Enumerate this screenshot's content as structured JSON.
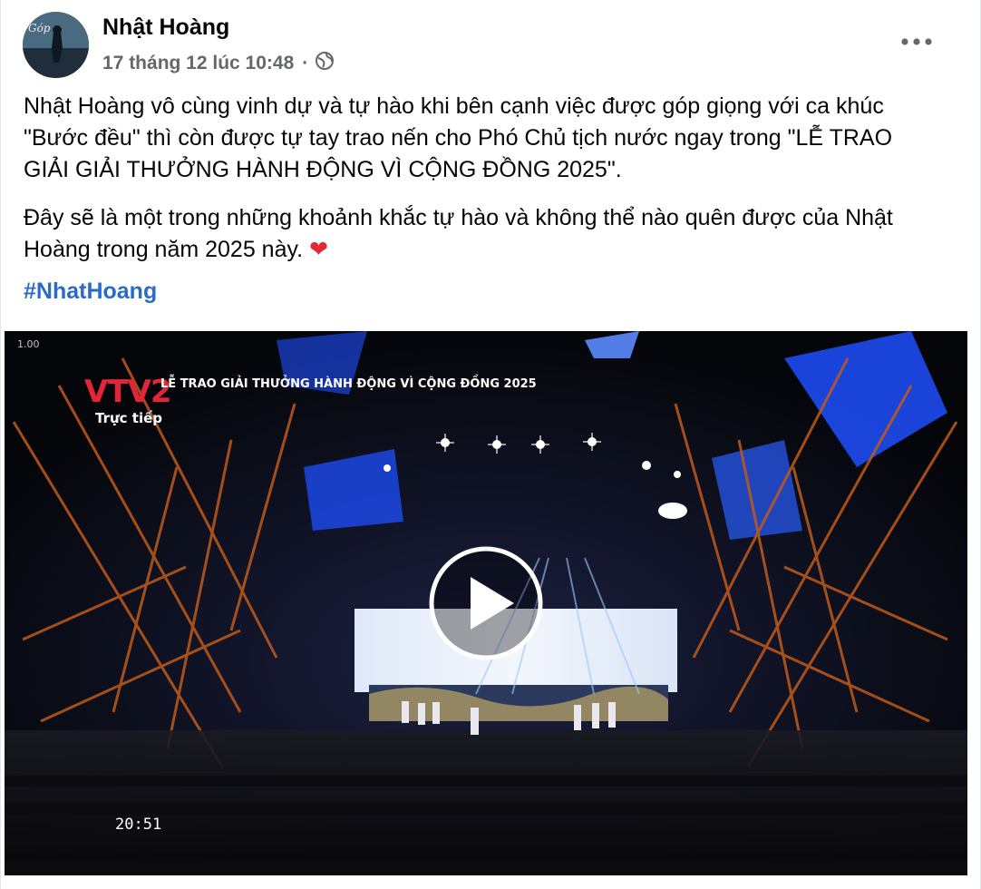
{
  "post": {
    "author": "Nhật Hoàng",
    "timestamp": "17 tháng 12 lúc 10:48",
    "separator": "·",
    "audience_icon": "globe-icon",
    "more_icon": "more-horizontal-icon",
    "paragraphs": [
      "Nhật Hoàng vô cùng vinh dự và tự hào khi bên cạnh việc được góp giọng với ca khúc \"Bước đều\" thì còn được tự tay trao nến cho Phó Chủ tịch nước ngay trong \"LỄ TRAO GIẢI GIẢI THƯỞNG HÀNH ĐỘNG VÌ CỘNG ĐỒNG 2025\".",
      "Đây sẽ là một trong những khoảnh khắc tự hào và không thể nào quên được của Nhật Hoàng trong năm 2025 này."
    ],
    "heart_emoji": "❤",
    "hashtag": "#NhatHoang"
  },
  "video": {
    "channel_logo": "VTV2",
    "broadcast_title": "LỄ TRAO GIẢI THƯỞNG HÀNH ĐỘNG VÌ CỘNG ĐỒNG 2025",
    "live_label": "Trực tiếp",
    "clock": "20:51",
    "corner_label": "1.00",
    "play_icon": "play-icon"
  },
  "colors": {
    "text": "#050505",
    "secondary": "#65676b",
    "link": "#2a6bc7",
    "heart": "#e0283b",
    "stage_blue": "#1f4fff"
  }
}
